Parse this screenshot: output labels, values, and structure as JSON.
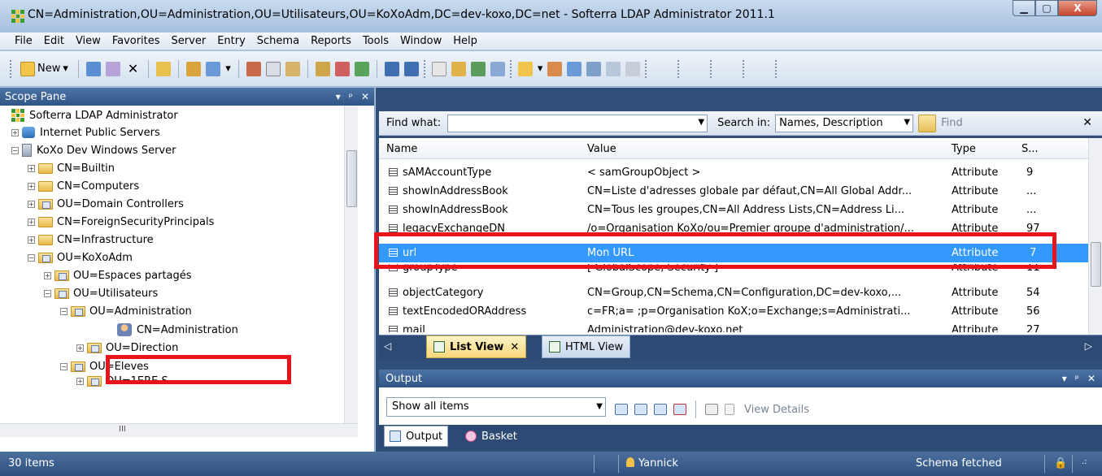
{
  "window": {
    "title": "CN=Administration,OU=Administration,OU=Utilisateurs,OU=KoXoAdm,DC=dev-koxo,DC=net - Softerra LDAP Administrator 2011.1",
    "minimize": "▁",
    "maximize": "▢",
    "close": "X"
  },
  "menu": [
    "File",
    "Edit",
    "View",
    "Favorites",
    "Server",
    "Entry",
    "Schema",
    "Reports",
    "Tools",
    "Window",
    "Help"
  ],
  "toolbar": {
    "new_label": "New"
  },
  "scope_pane": {
    "title": "Scope Pane",
    "controls": [
      "▾",
      "ᵖ",
      "✕"
    ],
    "tree": {
      "root": "Softerra LDAP Administrator",
      "internet": "Internet Public Servers",
      "server": "KoXo Dev Windows Server",
      "builtin": "CN=Builtin",
      "computers": "CN=Computers",
      "dc": "OU=Domain Controllers",
      "fsp": "CN=ForeignSecurityPrincipals",
      "infra": "CN=Infrastructure",
      "koxoadm": "OU=KoXoAdm",
      "espaces": "OU=Espaces partagés",
      "utilisateurs": "OU=Utilisateurs",
      "administration_ou": "OU=Administration",
      "administration_cn": "CN=Administration",
      "direction": "OU=Direction",
      "eleves": "OU=Eleves",
      "partial": "OU=1ERE S"
    },
    "hscroll_label": "III"
  },
  "find": {
    "label": "Find what:",
    "search_in_label": "Search in:",
    "search_in_value": "Names, Description",
    "find_button": "Find",
    "close": "✕"
  },
  "list": {
    "columns": [
      "Name",
      "Value",
      "Type",
      "S..."
    ],
    "rows": [
      {
        "name": "sAMAccountType",
        "value": "< samGroupObject >",
        "type": "Attribute",
        "size": "9"
      },
      {
        "name": "showInAddressBook",
        "value": "CN=Liste d'adresses globale par défaut,CN=All Global Addr...",
        "type": "Attribute",
        "size": "..."
      },
      {
        "name": "showInAddressBook",
        "value": "CN=Tous les groupes,CN=All Address Lists,CN=Address Li...",
        "type": "Attribute",
        "size": "..."
      },
      {
        "name": "legacyExchangeDN",
        "value": "/o=Organisation KoXo/ou=Premier groupe d'administration/...",
        "type": "Attribute",
        "size": "97"
      },
      {
        "name": "url",
        "value": "Mon URL",
        "type": "Attribute",
        "size": "7"
      },
      {
        "name": "groupType",
        "value": "[ GlobalScope, Security ]",
        "type": "Attribute",
        "size": "11"
      },
      {
        "name": "objectCategory",
        "value": "CN=Group,CN=Schema,CN=Configuration,DC=dev-koxo,...",
        "type": "Attribute",
        "size": "54"
      },
      {
        "name": "textEncodedORAddress",
        "value": "c=FR;a= ;p=Organisation KoX;o=Exchange;s=Administrati...",
        "type": "Attribute",
        "size": "56"
      },
      {
        "name": "mail",
        "value": "Administration@dev-koxo.net",
        "type": "Attribute",
        "size": "27"
      }
    ]
  },
  "doc_tabs": {
    "list_view": "List View",
    "list_view_close": "✕",
    "html_view": "HTML View",
    "left_arrow": "◁",
    "right_arrow": "▷"
  },
  "output": {
    "title": "Output",
    "controls": [
      "▾",
      "ᵖ",
      "✕"
    ],
    "filter_value": "Show all items",
    "view_details": "View Details",
    "tab_output": "Output",
    "tab_basket": "Basket"
  },
  "status": {
    "items_count": "30 items",
    "user": "Yannick",
    "schema": "Schema fetched"
  }
}
